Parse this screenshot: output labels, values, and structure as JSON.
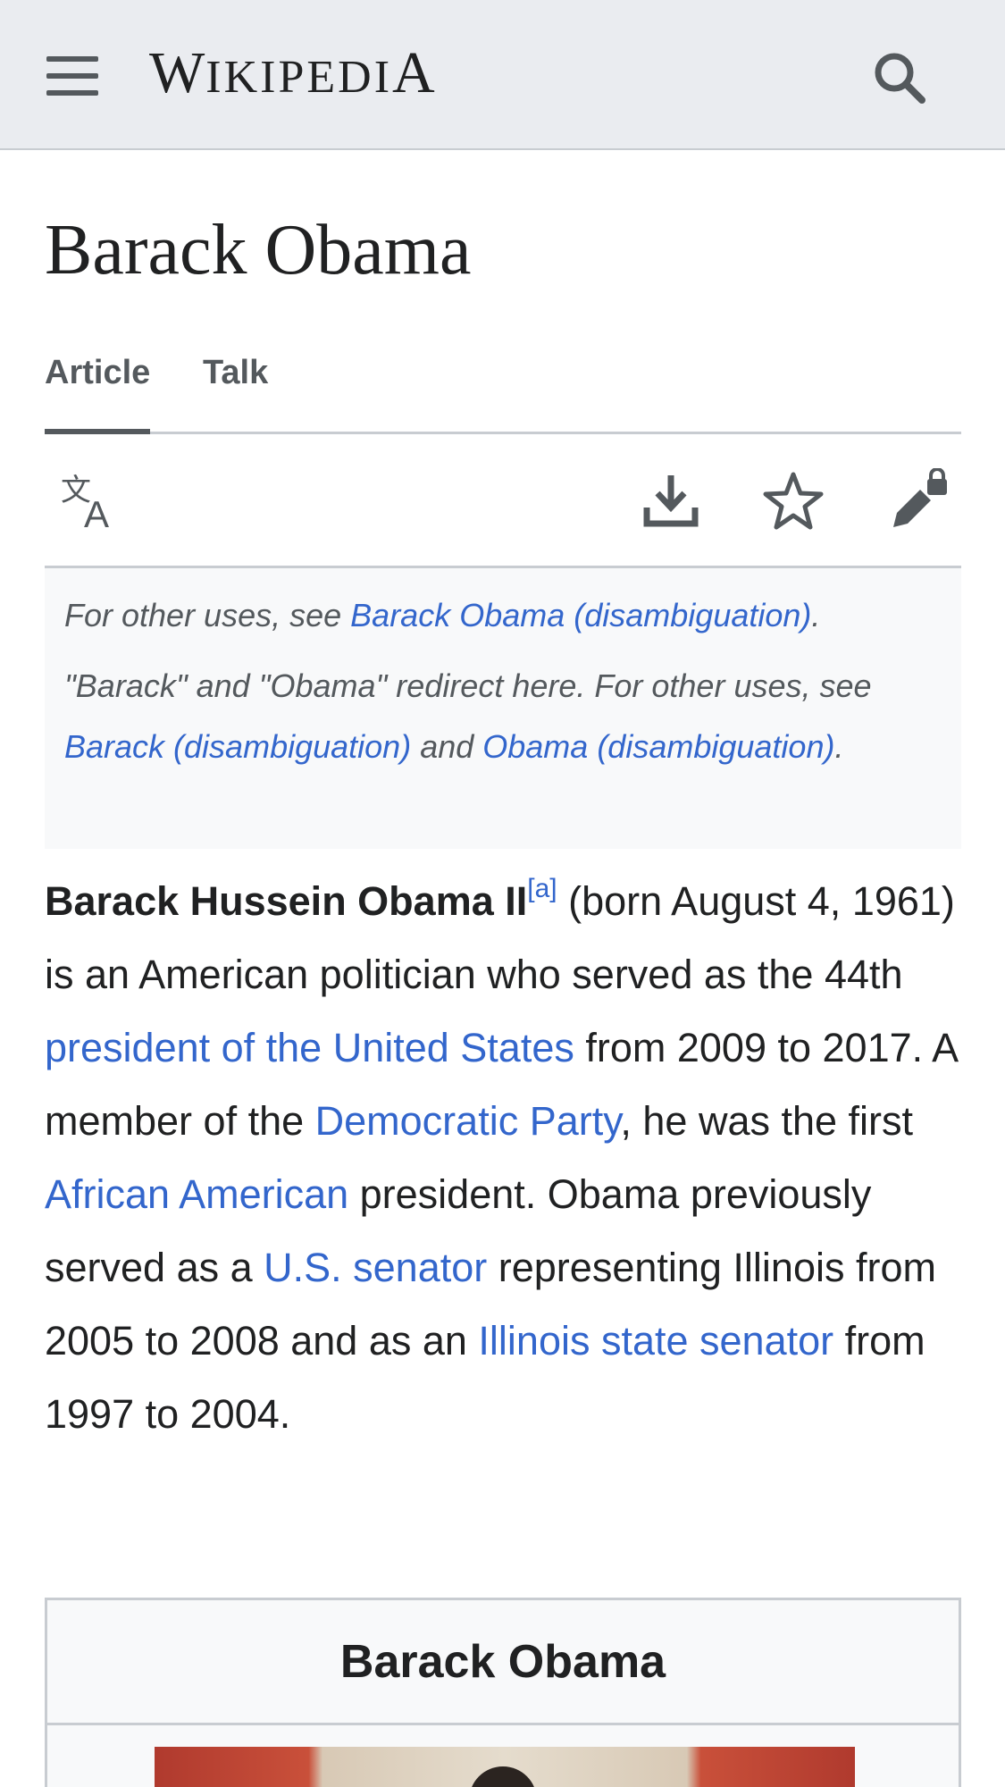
{
  "header": {
    "logo_big_w": "W",
    "logo_rest": "IKIPEDI",
    "logo_big_a": "A",
    "menu_icon": "hamburger-menu-icon",
    "search_icon": "search-icon"
  },
  "page": {
    "title": "Barack Obama"
  },
  "tabs": [
    {
      "label": "Article",
      "active": true
    },
    {
      "label": "Talk",
      "active": false
    }
  ],
  "actions": {
    "language_icon": "language-icon",
    "download_icon": "download-icon",
    "watch_icon": "star-icon",
    "edit_icon": "edit-lock-icon"
  },
  "hatnote": {
    "line1_prefix": "For other uses, see ",
    "line1_link": "Barack Obama (disambiguation)",
    "line1_suffix": ".",
    "line2_prefix": "\"Barack\" and \"Obama\" redirect here. For other uses, see ",
    "line2_link1": "Barack (disambiguation)",
    "line2_mid": " and ",
    "line2_link2": "Obama (disambiguation)",
    "line2_suffix": "."
  },
  "lead": {
    "name": "Barack Hussein Obama II",
    "footnote": "[a]",
    "t1": " (born August 4, 1961) is an American politician who served as the 44th ",
    "l1": "president of the United States",
    "t2": " from 2009 to 2017. A member of the ",
    "l2": "Democratic Party",
    "t3": ", he was the first ",
    "l3": "African American",
    "t4": " president. Obama previously served as a ",
    "l4": "U.S. senator",
    "t5": " representing Illinois from 2005 to 2008 and as an ",
    "l5": "Illinois state senator",
    "t6": " from 1997 to 2004."
  },
  "infobox": {
    "title": "Barack Obama"
  },
  "colors": {
    "link": "#3366cc",
    "header_bg": "#eaecf0",
    "text": "#202122",
    "muted": "#54595d",
    "border": "#c8ccd1"
  }
}
